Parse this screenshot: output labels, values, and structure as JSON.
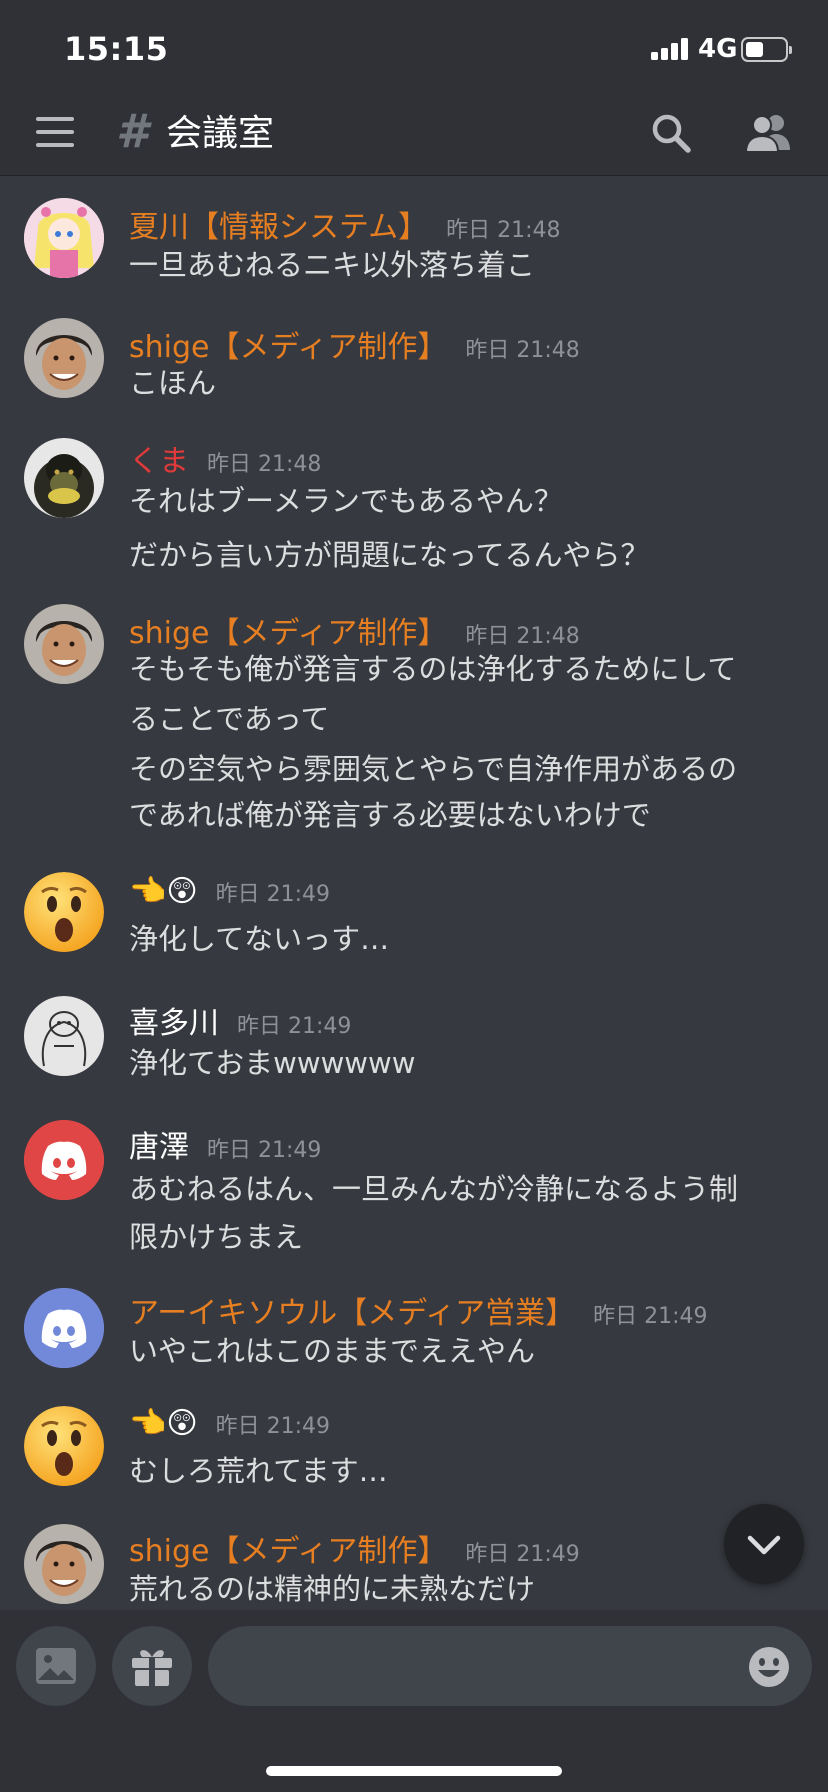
{
  "status": {
    "time": "15:15",
    "network": "4G"
  },
  "channel": {
    "name": "会議室"
  },
  "colors": {
    "orange": "#e67e22",
    "red": "#e03a3a",
    "white": "#ffffff"
  },
  "messages": [
    {
      "name": "夏川【情報システム】",
      "name_color": "orange",
      "timestamp": "昨日 21:48",
      "avatar": "anime-girl-avatar",
      "lines": [
        "一旦あむねるニキ以外落ち着こ"
      ]
    },
    {
      "name": "shige【メディア制作】",
      "name_color": "orange",
      "timestamp": "昨日 21:48",
      "avatar": "man-face-avatar",
      "lines": [
        "こほん"
      ]
    },
    {
      "name": "くま",
      "name_color": "red",
      "timestamp": "昨日 21:48",
      "avatar": "gorilla-avatar",
      "lines": [
        "それはブーメランでもあるやん？",
        "だから言い方が問題になってるんやら？"
      ]
    },
    {
      "name": "shige【メディア制作】",
      "name_color": "orange",
      "timestamp": "昨日 21:48",
      "avatar": "man-face-avatar",
      "lines": [
        "そもそも俺が発言するのは浄化するためにして",
        "ることであって",
        "その空気やら雰囲気とやらで自浄作用があるの",
        "であれば俺が発言する必要はないわけで"
      ]
    },
    {
      "name": "👈😲",
      "name_color": "white",
      "timestamp": "昨日 21:49",
      "avatar": "surprised-emoji-avatar",
      "lines": [
        "浄化してないっす…"
      ]
    },
    {
      "name": "喜多川",
      "name_color": "white",
      "timestamp": "昨日 21:49",
      "avatar": "sketch-avatar",
      "lines": [
        "浄化ておまwwwwww"
      ]
    },
    {
      "name": "唐澤",
      "name_color": "white",
      "timestamp": "昨日 21:49",
      "avatar": "discord-red-avatar",
      "lines": [
        "あむねるはん、一旦みんなが冷静になるよう制",
        "限かけちまえ"
      ]
    },
    {
      "name": "アーイキソウル【メディア営業】",
      "name_color": "orange",
      "timestamp": "昨日 21:49",
      "avatar": "discord-blurple-avatar",
      "lines": [
        "いやこれはこのままでええやん"
      ]
    },
    {
      "name": "👈😲",
      "name_color": "white",
      "timestamp": "昨日 21:49",
      "avatar": "surprised-emoji-avatar",
      "lines": [
        "むしろ荒れてます…"
      ]
    },
    {
      "name": "shige【メディア制作】",
      "name_color": "orange",
      "timestamp": "昨日 21:49",
      "avatar": "man-face-avatar",
      "lines": [
        "荒れるのは精神的に未熟なだけ"
      ]
    }
  ]
}
